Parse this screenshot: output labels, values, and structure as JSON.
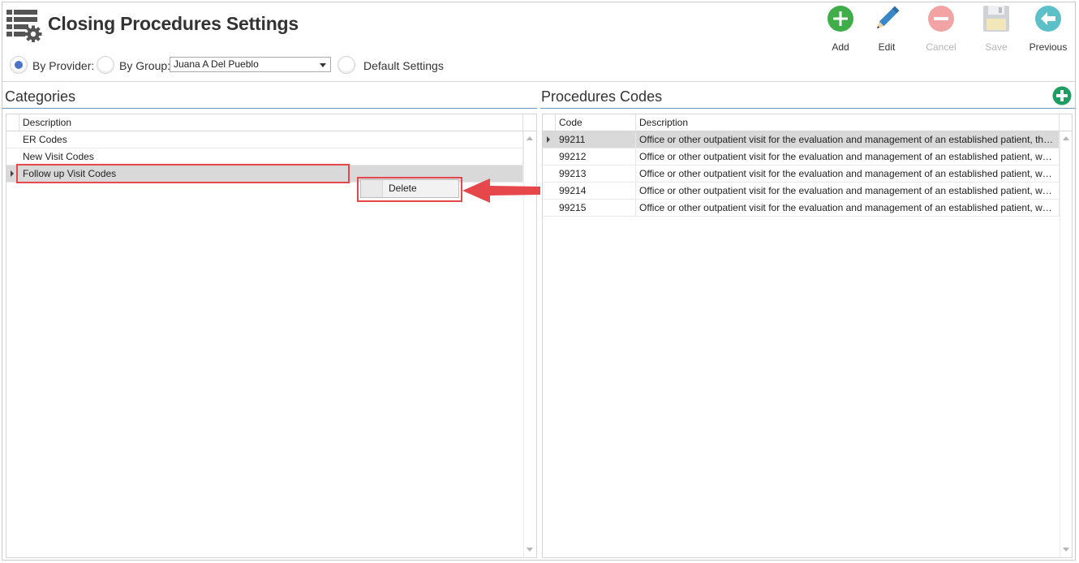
{
  "app": {
    "title": "Closing Procedures Settings",
    "icon": "settings-list-icon"
  },
  "toolbar": {
    "add": "Add",
    "edit": "Edit",
    "cancel": "Cancel",
    "save": "Save",
    "previous": "Previous"
  },
  "filters": {
    "by_provider": "By Provider:",
    "by_group": "By Group:",
    "provider_selected": "Juana A Del Pueblo",
    "default_settings": "Default Settings",
    "selected_option": "By Provider"
  },
  "categories": {
    "title": "Categories",
    "columns": [
      "Description"
    ],
    "rows": [
      "ER Codes",
      "New Visit Codes",
      "Follow up Visit Codes"
    ],
    "selected_index": 2
  },
  "context_menu": {
    "items": [
      "Delete"
    ]
  },
  "procedures": {
    "title": "Procedures Codes",
    "columns": [
      "Code",
      "Description"
    ],
    "rows": [
      {
        "code": "99211",
        "description": "Office or other outpatient visit for the evaluation and management of an established patient, th…"
      },
      {
        "code": "99212",
        "description": "Office or other outpatient visit for the evaluation and management of an established patient, w…"
      },
      {
        "code": "99213",
        "description": "Office or other outpatient visit for the evaluation and management of an established patient, w…"
      },
      {
        "code": "99214",
        "description": "Office or other outpatient visit for the evaluation and management of an established patient, w…"
      },
      {
        "code": "99215",
        "description": "Office or other outpatient visit for the evaluation and management of an established patient, w…"
      }
    ],
    "selected_index": 0
  },
  "colors": {
    "add_green": "#3fae49",
    "edit_blue": "#3a87c8",
    "cancel_red": "#f2a3a3",
    "previous_teal": "#5cc0c8",
    "annotation_red": "#e5474b",
    "panel_line": "#6f98b8"
  }
}
